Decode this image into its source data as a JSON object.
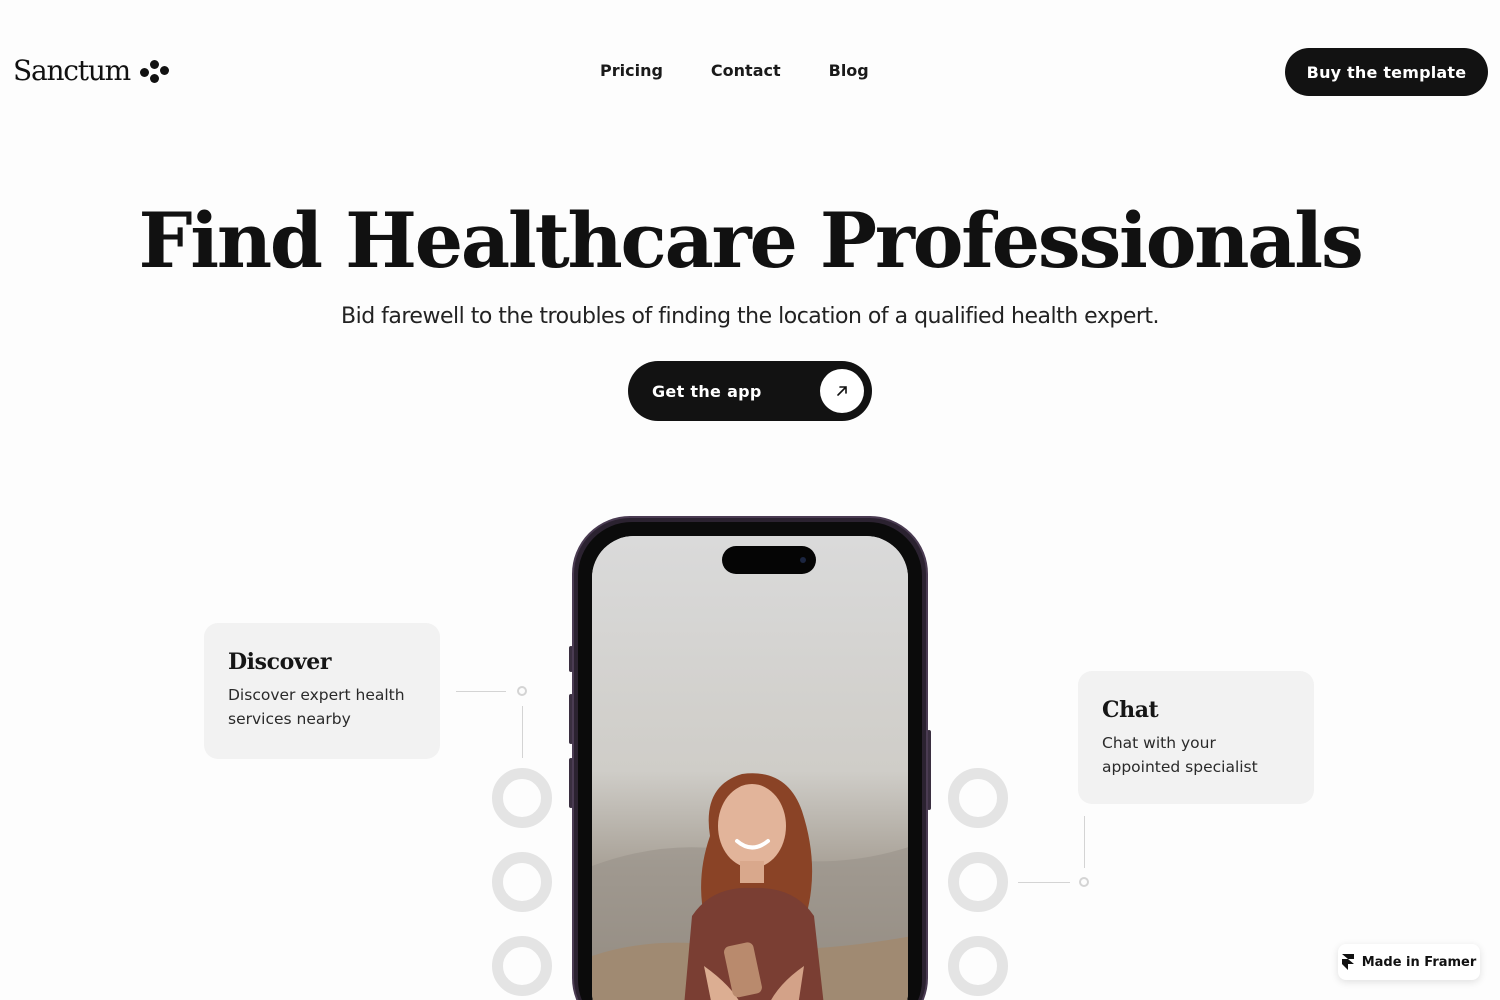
{
  "header": {
    "logo_text": "Sanctum",
    "nav": [
      "Pricing",
      "Contact",
      "Blog"
    ],
    "buy_label": "Buy the template"
  },
  "hero": {
    "title": "Find Healthcare Professionals",
    "subtitle": "Bid farewell to the troubles of finding the location of a qualified health expert.",
    "cta_label": "Get the app",
    "cta_icon": "arrow-up-right-icon"
  },
  "features": {
    "discover": {
      "title": "Discover",
      "desc": "Discover expert health services nearby"
    },
    "chat": {
      "title": "Chat",
      "desc": "Chat with your appointed specialist"
    }
  },
  "badge": {
    "label": "Made in Framer",
    "icon": "framer-icon"
  },
  "colors": {
    "primary": "#121212",
    "card": "#f2f2f2",
    "background": "#fdfdfd",
    "ring": "#e4e4e4"
  }
}
